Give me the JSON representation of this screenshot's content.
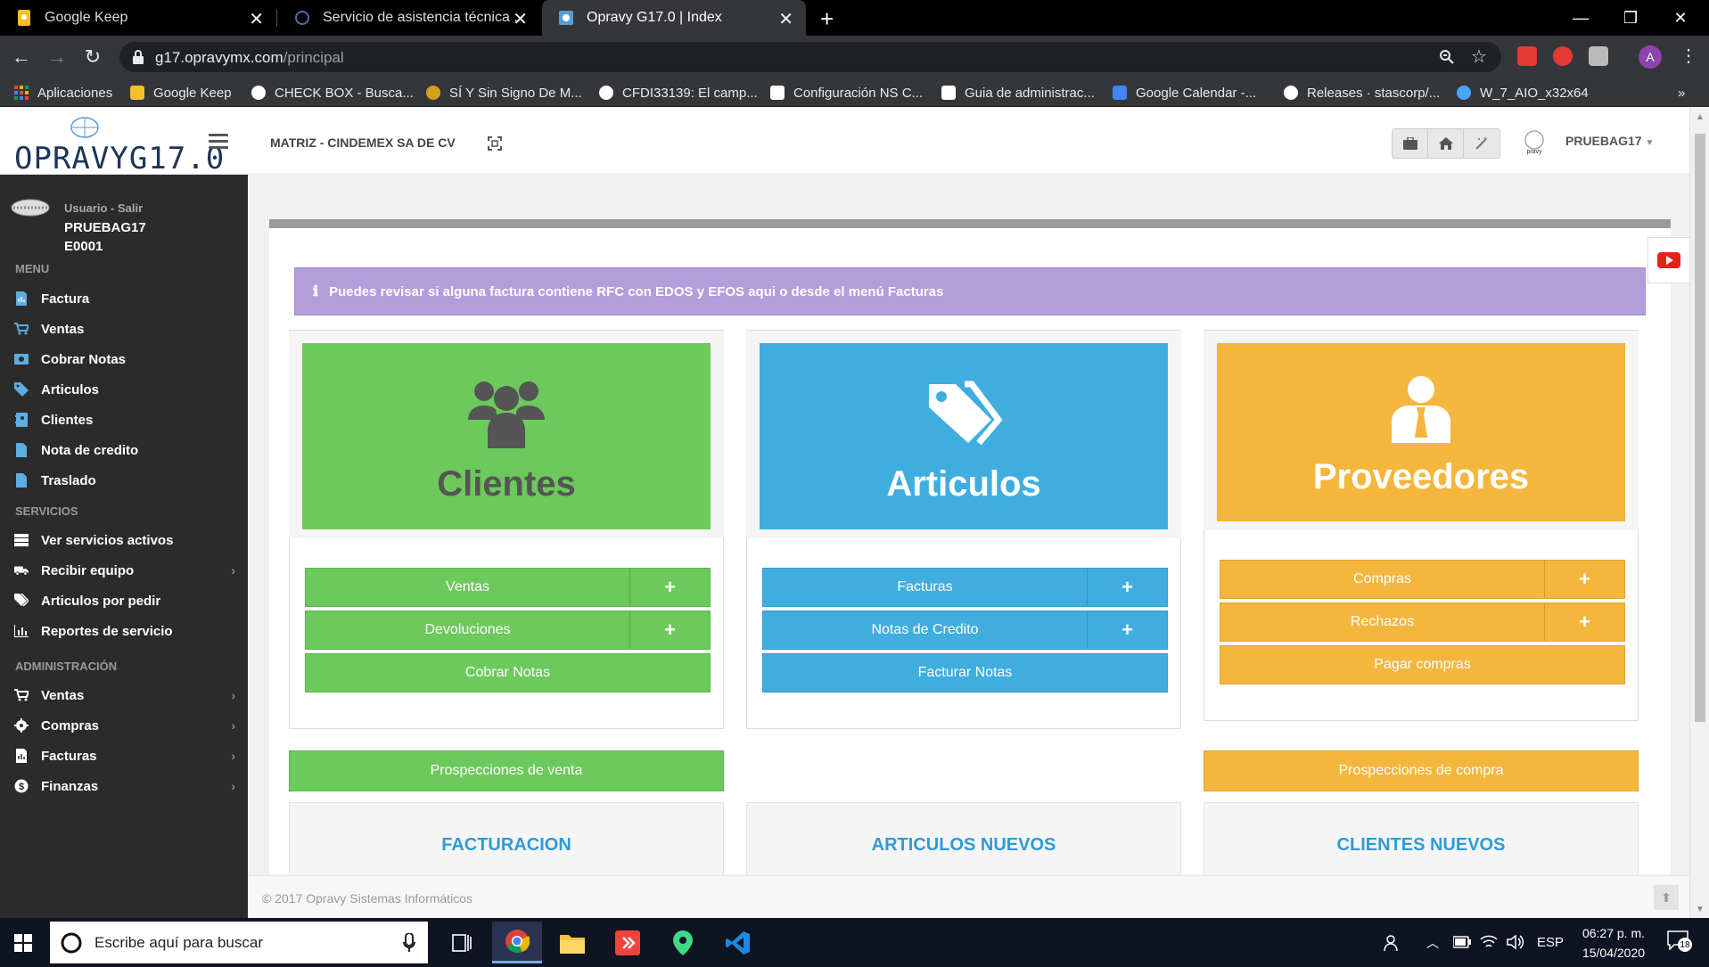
{
  "browser": {
    "tabs": [
      {
        "title": "Google Keep",
        "active": false
      },
      {
        "title": "Servicio de asistencia técnica : Op",
        "active": false
      },
      {
        "title": "Opravy G17.0 | Index",
        "active": true
      }
    ],
    "url_host": "g17.opravymx.com",
    "url_path": "/principal",
    "profile_initial": "A",
    "bookmarks": [
      {
        "label": "Aplicaciones",
        "icon": "apps-grid-icon",
        "color": "#e8453c"
      },
      {
        "label": "Google Keep",
        "icon": "keep-icon",
        "color": "#f6bf26"
      },
      {
        "label": "CHECK BOX - Busca...",
        "icon": "google-icon",
        "color": "#ffffff"
      },
      {
        "label": "SÍ Y Sin Signo De M...",
        "icon": "bookmark-site-icon",
        "color": "#d4a017"
      },
      {
        "label": "CFDI33139: El camp...",
        "icon": "globe-icon",
        "color": "#ffffff"
      },
      {
        "label": "Configuración NS C...",
        "icon": "k-icon",
        "color": "#ffffff"
      },
      {
        "label": "Guia de administrac...",
        "icon": "k-icon",
        "color": "#ffffff"
      },
      {
        "label": "Google Calendar -...",
        "icon": "calendar-icon",
        "color": "#4285f4"
      },
      {
        "label": "Releases · stascorp/...",
        "icon": "github-icon",
        "color": "#ffffff"
      },
      {
        "label": "W_7_AIO_x32x64",
        "icon": "download-icon",
        "color": "#4aa3ff"
      }
    ]
  },
  "app": {
    "logo": "OPRAVYG17.0",
    "company": "MATRIZ - CINDEMEX SA DE CV",
    "user_top": "PRUEBAG17"
  },
  "sidebar": {
    "user_label": "Usuario - Salir",
    "user_name": "PRUEBAG17",
    "user_code": "E0001",
    "sections": {
      "menu": "MENU",
      "servicios": "SERVICIOS",
      "administracion": "ADMINISTRACIÓN"
    },
    "menu_items": [
      {
        "label": "Factura",
        "icon": "invoice-icon"
      },
      {
        "label": "Ventas",
        "icon": "cart-icon"
      },
      {
        "label": "Cobrar Notas",
        "icon": "money-icon"
      },
      {
        "label": "Articulos",
        "icon": "tag-icon"
      },
      {
        "label": "Clientes",
        "icon": "address-book-icon"
      },
      {
        "label": "Nota de credito",
        "icon": "file-icon"
      },
      {
        "label": "Traslado",
        "icon": "file-icon"
      }
    ],
    "servicios_items": [
      {
        "label": "Ver servicios activos",
        "icon": "server-icon"
      },
      {
        "label": "Recibir equipo",
        "icon": "truck-icon"
      },
      {
        "label": "Articulos por pedir",
        "icon": "tags-icon"
      },
      {
        "label": "Reportes de servicio",
        "icon": "bar-chart-icon"
      }
    ],
    "admin_items": [
      {
        "label": "Ventas",
        "icon": "cart-icon"
      },
      {
        "label": "Compras",
        "icon": "gear-icon"
      },
      {
        "label": "Facturas",
        "icon": "invoice-icon"
      },
      {
        "label": "Finanzas",
        "icon": "dollar-icon"
      }
    ]
  },
  "alert": "Puedes revisar si alguna factura contiene RFC con EDOS y EFOS aqui o desde el menú Facturas",
  "cards": {
    "clientes": {
      "title": "Clientes",
      "buttons": [
        "Ventas",
        "Devoluciones",
        "Cobrar Notas"
      ],
      "plus": "+"
    },
    "articulos": {
      "title": "Articulos",
      "buttons": [
        "Facturas",
        "Notas de Credito",
        "Facturar Notas"
      ],
      "plus": "+"
    },
    "proveedores": {
      "title": "Proveedores",
      "buttons": [
        "Compras",
        "Rechazos",
        "Pagar compras"
      ],
      "plus": "+"
    }
  },
  "prospecciones": {
    "venta": "Prospecciones de venta",
    "compra": "Prospecciones de compra"
  },
  "bottom_cards": [
    "FACTURACION",
    "ARTICULOS NUEVOS",
    "CLIENTES NUEVOS"
  ],
  "footer": "© 2017 Opravy Sistemas Informáticos",
  "taskbar": {
    "search_placeholder": "Escribe aquí para buscar",
    "lang": "ESP",
    "time": "06:27 p. m.",
    "date": "15/04/2020",
    "notifications": "18"
  },
  "colors": {
    "green": "#6cc95b",
    "blue": "#3faedf",
    "orange": "#f4b63d",
    "alert": "#b39ddb",
    "sidebar": "#2b2b2b"
  }
}
